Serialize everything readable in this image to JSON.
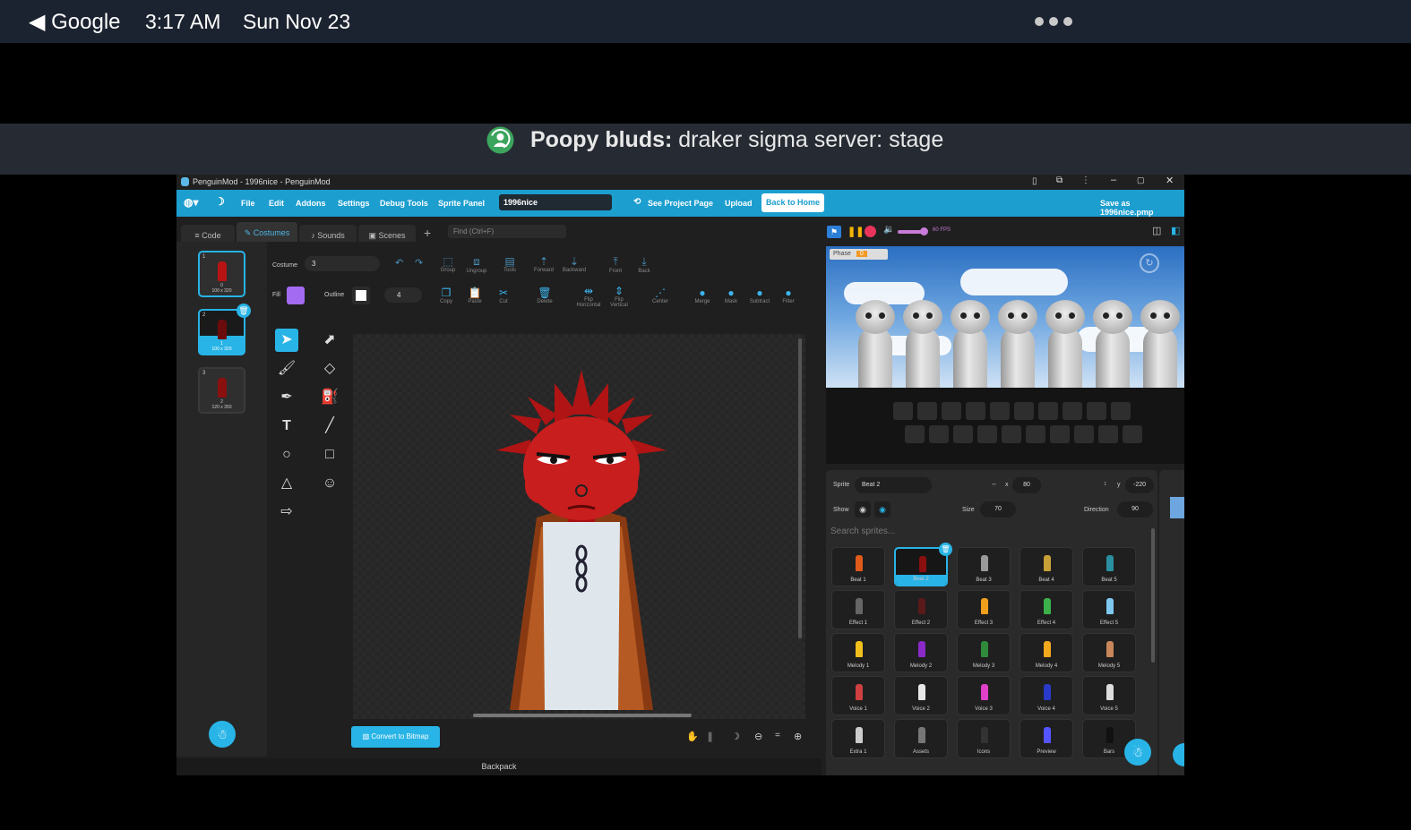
{
  "status_bar": {
    "back_label": "◀ Google",
    "time": "3:17 AM",
    "date": "Sun Nov 23"
  },
  "stream": {
    "server_bold": "Poopy bluds:",
    "channel": "draker sigma server: stage"
  },
  "window": {
    "title": "PenguinMod - 1996nice - PenguinMod",
    "menu": {
      "file": "File",
      "edit": "Edit",
      "addons": "Addons",
      "settings": "Settings",
      "debug": "Debug Tools",
      "sprite_panel": "Sprite Panel"
    },
    "project_name": "1996nice",
    "see_project": "See Project Page",
    "upload": "Upload",
    "back_home": "Back to Home",
    "save_as": "Save as 1996nice.pmp"
  },
  "tabs": {
    "code": "Code",
    "costumes": "Costumes",
    "sounds": "Sounds",
    "scenes": "Scenes",
    "find_placeholder": "Find (Ctrl+F)"
  },
  "costumes": [
    {
      "num": "1",
      "name": "0",
      "size": "100 x 320"
    },
    {
      "num": "2",
      "name": "1",
      "size": "100 x 320"
    },
    {
      "num": "3",
      "name": "2",
      "size": "120 x 350"
    }
  ],
  "paint": {
    "costume_label": "Costume",
    "costume_value": "3",
    "fill_label": "Fill",
    "outline_label": "Outline",
    "outline_width": "4",
    "fill_color": "#a36bf2",
    "group_actions": [
      "Group",
      "Ungroup",
      "Tools",
      "Forward",
      "Backward",
      "Front",
      "Back"
    ],
    "edit_actions": [
      "Copy",
      "Paste",
      "Cut",
      "Delete",
      "Flip Horizontal",
      "Flip Vertical",
      "Center",
      "Merge",
      "Mask",
      "Subtract",
      "Filter"
    ],
    "convert_label": "Convert to Bitmap",
    "zoom_reset": "="
  },
  "backpack_label": "Backpack",
  "stage": {
    "phase_label": "Phase",
    "phase_value": "0",
    "fps": "60 FPS"
  },
  "sprite_info": {
    "sprite_label": "Sprite",
    "sprite_name": "Beat 2",
    "x_label": "x",
    "x_value": "80",
    "y_label": "y",
    "y_value": "-220",
    "show_label": "Show",
    "size_label": "Size",
    "size_value": "70",
    "direction_label": "Direction",
    "direction_value": "90",
    "search_placeholder": "Search sprites..."
  },
  "sprites": [
    [
      "Beat 1",
      "Beat 2",
      "Beat 3",
      "Beat 4",
      "Beat 5"
    ],
    [
      "Effect 1",
      "Effect 2",
      "Effect 3",
      "Effect 4",
      "Effect 5"
    ],
    [
      "Melody 1",
      "Melody 2",
      "Melody 3",
      "Melody 4",
      "Melody 5"
    ],
    [
      "Voice 1",
      "Voice 2",
      "Voice 3",
      "Voice 4",
      "Voice 5"
    ],
    [
      "Extra 1",
      "Assets",
      "Icons",
      "Preview",
      "Bars"
    ]
  ],
  "colors": {
    "accent": "#28b4e6",
    "menubar": "#1c9ecf",
    "character": "#c81e1e"
  }
}
